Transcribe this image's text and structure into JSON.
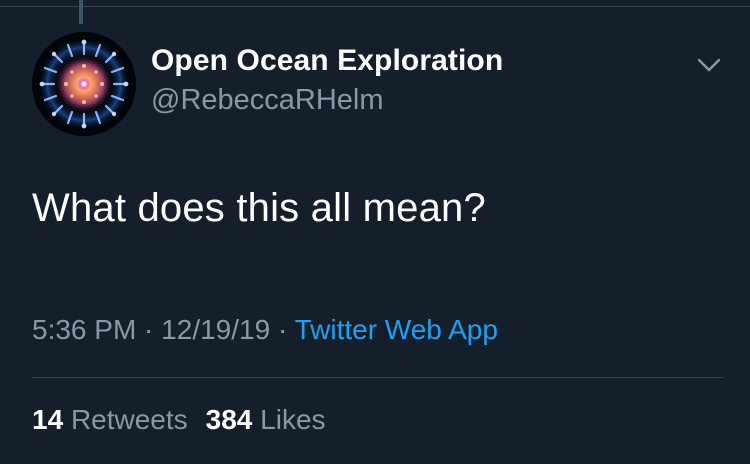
{
  "colors": {
    "background": "#151f2b",
    "primary_text": "#ffffff",
    "secondary_text": "#8899a6",
    "accent": "#1da1f2",
    "divider": "#37444d"
  },
  "tweet": {
    "author": {
      "display_name": "Open Ocean Exploration",
      "handle": "@RebeccaRHelm",
      "avatar_icon": "jellyfish-avatar"
    },
    "menu_icon": "chevron-down-icon",
    "text": "What does this all mean?",
    "time": "5:36 PM",
    "separator": " · ",
    "date": "12/19/19",
    "source": "Twitter Web App",
    "stats": {
      "retweets_count": "14",
      "retweets_label": "Retweets",
      "likes_count": "384",
      "likes_label": "Likes"
    }
  }
}
